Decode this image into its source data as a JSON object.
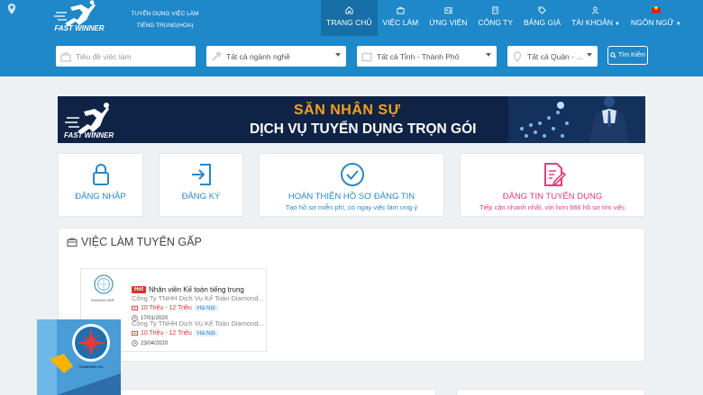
{
  "header": {
    "logo_text": "FAST WINNER",
    "tagline_line1": "TUYỂN DỤNG VIỆC LÀM",
    "tagline_line2": "TIẾNG TRUNG(HOA)",
    "nav": [
      {
        "label": "TRANG CHỦ",
        "icon": "home-icon",
        "active": true
      },
      {
        "label": "VIỆC LÀM",
        "icon": "briefcase-icon"
      },
      {
        "label": "ỨNG VIÊN",
        "icon": "id-card-icon"
      },
      {
        "label": "CÔNG TY",
        "icon": "building-icon"
      },
      {
        "label": "BẢNG GIÁ",
        "icon": "price-tag-icon"
      },
      {
        "label": "TÀI KHOẢN",
        "icon": "user-icon",
        "dropdown": true
      },
      {
        "label": "NGÔN NGỮ",
        "icon": "vietnam-flag-icon",
        "dropdown": true
      }
    ]
  },
  "search": {
    "keyword_placeholder": "Tiêu đề việc làm",
    "industry": "Tất cả ngành nghề",
    "province": "Tất cả Tỉnh - Thành Phố",
    "district": "Tất cả Quận - ...",
    "button_label": "Tìm Kiếm"
  },
  "banner": {
    "logo_text": "FAST WINNER",
    "line1": "SĂN NHÂN SỰ",
    "line2": "DỊCH VỤ TUYỂN DỤNG TRỌN GÓI"
  },
  "actions": {
    "login": {
      "title": "ĐĂNG NHẬP",
      "icon": "lock-icon"
    },
    "register": {
      "title": "ĐĂNG KÝ",
      "icon": "sign-in-icon"
    },
    "profile": {
      "title": "HOÀN THIỆN HỒ SƠ ĐĂNG TIN",
      "subtitle": "Tạo hồ sơ miễn phí, có ngay việc làm ưng ý",
      "icon": "check-circle-icon"
    },
    "post": {
      "title": "ĐĂNG TIN TUYỂN DỤNG",
      "subtitle": "Tiếp cận nhanh nhất, với hơn 666 hồ sơ tìm việc",
      "icon": "edit-document-icon"
    }
  },
  "urgent": {
    "heading": "VIỆC LÀM TUYỂN GẤP",
    "jobs": [
      {
        "hot_label": "Hot",
        "title": "Nhân viên Kế toán tiếng trung",
        "company": "Công Ty TNHH Dịch Vụ Kế Toán Diamond...",
        "company_logo_text": "DIAMOND HINE",
        "salary": "10 Triệu - 12 Triệu",
        "city": "Hà Nội",
        "date": "17/01/2020"
      },
      {
        "title": "",
        "company": "Công Ty TNHH Dịch Vụ Kế Toán Diamond...",
        "salary": "10 Triệu - 12 Triệu",
        "city": "Hà Nội",
        "date": "23/04/2020"
      }
    ]
  },
  "popup_ad": {
    "logo_text": "DIAMOND CO."
  },
  "colors": {
    "primary": "#1e88c9",
    "nav_active": "#166fa6",
    "accent_pink": "#e0407b",
    "hot_red": "#d9342b",
    "banner_bg": "#0f2346",
    "banner_orange": "#f7a020"
  }
}
